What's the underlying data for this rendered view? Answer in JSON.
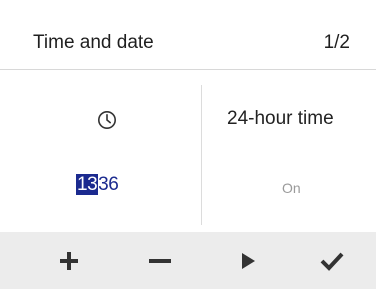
{
  "header": {
    "title": "Time and date",
    "page_indicator": "1/2"
  },
  "clock": {
    "icon": "clock-icon",
    "time_hours": "13",
    "time_minutes": "36"
  },
  "option": {
    "label": "24-hour time",
    "value": "On"
  },
  "toolbar": {
    "buttons": [
      "plus-icon",
      "minus-icon",
      "play-icon",
      "check-icon"
    ]
  },
  "colors": {
    "highlight": "#1b2a8f",
    "toolbar_bg": "#ececec",
    "icon": "#333333"
  }
}
